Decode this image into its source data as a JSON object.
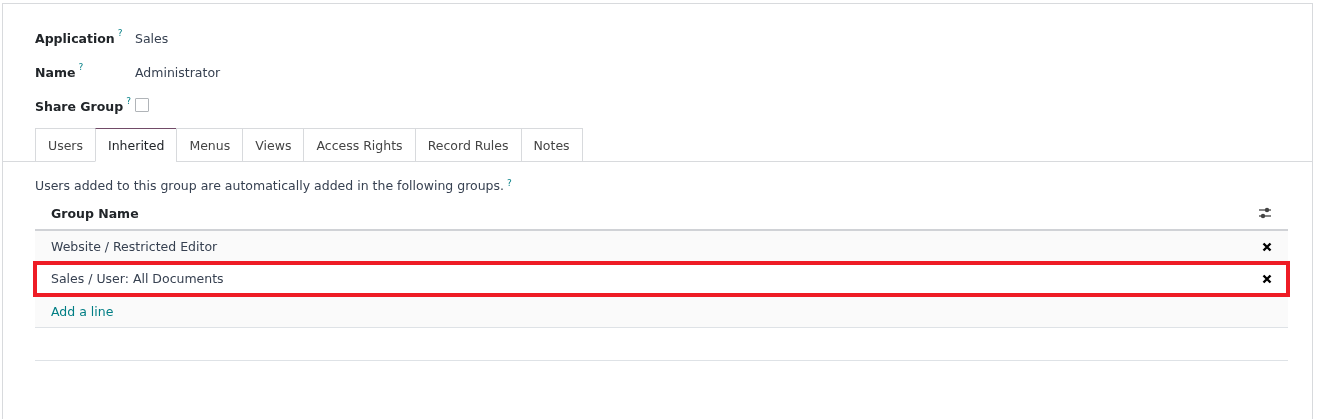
{
  "fields": [
    {
      "kind": "text",
      "label": "Application",
      "help": "?",
      "value": "Sales"
    },
    {
      "kind": "text",
      "label": "Name",
      "help": "?",
      "value": "Administrator"
    },
    {
      "kind": "checkbox",
      "label": "Share Group",
      "help": "?",
      "checked": false
    }
  ],
  "tabs": [
    {
      "label": "Users",
      "selected": false
    },
    {
      "label": "Inherited",
      "selected": true
    },
    {
      "label": "Menus",
      "selected": false
    },
    {
      "label": "Views",
      "selected": false
    },
    {
      "label": "Access Rights",
      "selected": false
    },
    {
      "label": "Record Rules",
      "selected": false
    },
    {
      "label": "Notes",
      "selected": false
    }
  ],
  "description": {
    "text": "Users added to this group are automatically added in the following groups.",
    "help": "?"
  },
  "table": {
    "columns": [
      "Group Name"
    ],
    "rows": [
      {
        "group_name": "Website / Restricted Editor",
        "highlighted": false
      },
      {
        "group_name": "Sales / User: All Documents",
        "highlighted": true
      }
    ],
    "add_line": "Add a line"
  }
}
